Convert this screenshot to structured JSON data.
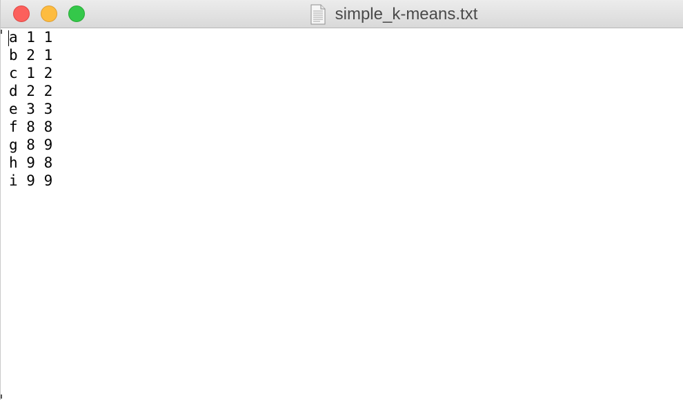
{
  "window": {
    "title": "simple_k-means.txt",
    "icons": {
      "close": "close-button",
      "minimize": "minimize-button",
      "zoom": "zoom-button",
      "document": "text-document-icon"
    },
    "colors": {
      "close": "#fc605c",
      "minimize": "#fdbc40",
      "zoom": "#34c84a"
    }
  },
  "editor": {
    "lines": [
      "a 1 1",
      "b 2 1",
      "c 1 2",
      "d 2 2",
      "e 3 3",
      "f 8 8",
      "g 8 9",
      "h 9 8",
      "i 9 9"
    ]
  }
}
